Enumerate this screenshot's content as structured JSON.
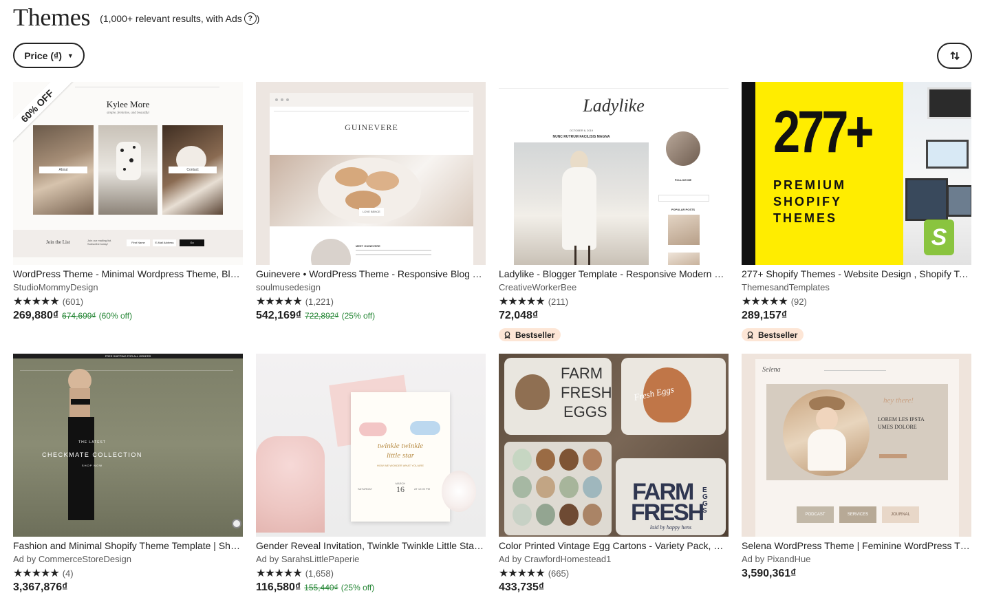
{
  "header": {
    "title": "Themes",
    "subtitle": "(1,000+ relevant results, with Ads",
    "subtitle_end": ")",
    "help": "?"
  },
  "filters": {
    "price_label": "Price (₫)"
  },
  "listings": [
    {
      "title": "WordPress Theme - Minimal Wordpress Theme, Blog Theme",
      "shop": "StudioMommyDesign",
      "stars": "★★★★★",
      "reviews": "(601)",
      "price": "269,880₫",
      "original_price": "674,699₫",
      "discount": "(60% off)",
      "thumb": {
        "ribbon": "60% OFF",
        "heading": "Kylee More",
        "tagline": "simple, feminine, and beautiful",
        "btn1": "About",
        "btn2": "Contact",
        "join": "Join the List",
        "signup": "Join our mailing list. Subscribe today!",
        "field1": "First Name",
        "field2": "E-Mail Address",
        "go": "Go"
      }
    },
    {
      "title": "Guinevere • WordPress Theme - Responsive Blog Template",
      "shop": "soulmusedesign",
      "stars": "★★★★★",
      "reviews": "(1,221)",
      "price": "542,169₫",
      "original_price": "722,892₫",
      "discount": "(25% off)",
      "thumb": {
        "heading": "GUINEVERE",
        "tag": "LOVE BENCE",
        "about": "MEET GUINEVERE"
      }
    },
    {
      "title": "Ladylike - Blogger Template - Responsive Modern Blog Theme",
      "shop": "CreativeWorkerBee",
      "stars": "★★★★★",
      "reviews": "(211)",
      "price": "72,048₫",
      "badge": "Bestseller",
      "thumb": {
        "logo": "Ladylike",
        "date": "OCTOBER 6, 2019",
        "post": "NUNC RUTRUM FACILISIS MAGNA",
        "follow": "FOLLOW ME",
        "popular": "POPULAR POSTS"
      }
    },
    {
      "title": "277+ Shopify Themes - Website Design , Shopify Templates",
      "shop": "ThemesandTemplates",
      "stars": "★★★★★",
      "reviews": "(92)",
      "price": "289,157₫",
      "badge": "Bestseller",
      "thumb": {
        "big": "277+",
        "line1": "PREMIUM",
        "line2": "SHOPIFY",
        "line3": "THEMES",
        "bag": "S"
      }
    },
    {
      "title": "Fashion and Minimal Shopify Theme Template | Shopify Store",
      "shop": "Ad by CommerceStoreDesign",
      "stars": "★★★★★",
      "reviews": "(4)",
      "price": "3,367,876₫",
      "thumb": {
        "topbar": "FREE SHIPPING FOR ALL ORDERS",
        "latest": "THE LATEST",
        "collection": "CHECKMATE COLLECTION",
        "shop": "SHOP NOW"
      }
    },
    {
      "title": "Gender Reveal Invitation, Twinkle Twinkle Little Star Invite",
      "shop": "Ad by SarahsLittlePaperie",
      "stars": "★★★★★",
      "reviews": "(1,658)",
      "price": "116,580₫",
      "original_price": "155,440₫",
      "discount": "(25% off)",
      "thumb": {
        "script1": "twinkle twinkle",
        "script2": "little star",
        "wonder": "HOW WE WONDER WHAT YOU ARE",
        "month": "MARCH",
        "day": "16",
        "weekday": "SATURDAY",
        "time": "AT 12:00 PM"
      }
    },
    {
      "title": "Color Printed Vintage Egg Cartons - Variety Pack, Farm Fresh",
      "shop": "Ad by CrawfordHomestead1",
      "stars": "★★★★★",
      "reviews": "(665)",
      "price": "433,735₫",
      "thumb": {
        "farm1": "FARM",
        "fresh1": "FRESH",
        "eggs1": "EGGS",
        "script": "Fresh Eggs",
        "farm2": "FARM",
        "fresh2": "FRESH",
        "eggs2": "EGGS",
        "tagline": "laid by happy hens"
      }
    },
    {
      "title": "Selena WordPress Theme | Feminine WordPress Theme",
      "shop": "Ad by PixandHue",
      "stars": "★★★★★",
      "price": "3,590,361₫",
      "thumb": {
        "logo": "Selena",
        "hello": "hey there!",
        "lorem": "LOREM LES IPSTA UMES DOLORE",
        "b1": "PODCAST",
        "b2": "SERVICES",
        "b3": "JOURNAL"
      }
    }
  ]
}
